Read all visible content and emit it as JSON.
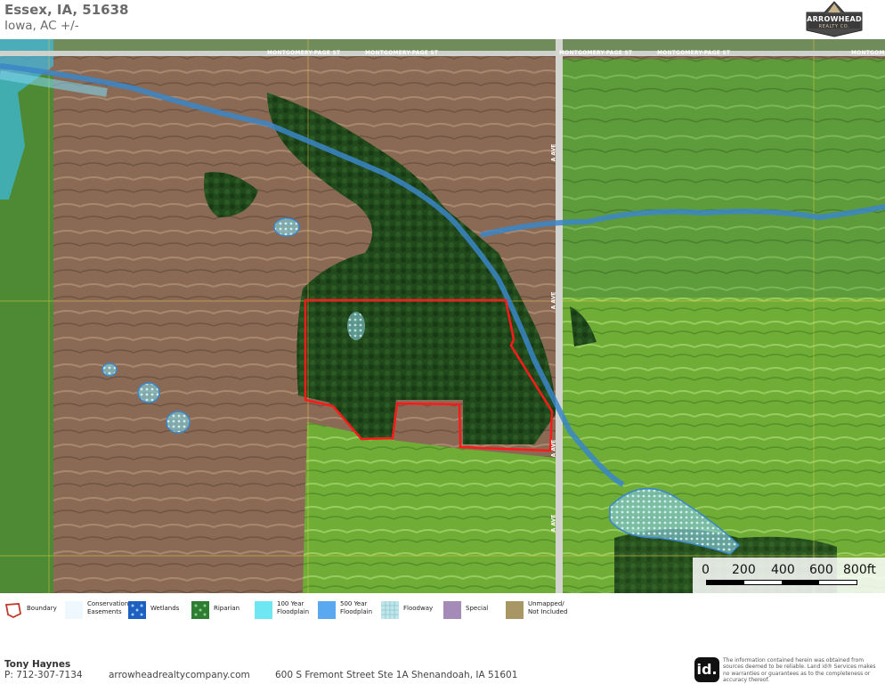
{
  "header": {
    "title": "Essex, IA, 51638",
    "subtitle": "Iowa,  AC +/-",
    "logo_text": "ARROWHEAD",
    "logo_sub": "REALTY CO."
  },
  "map": {
    "road_labels": [
      "MONTGOMERY-PAGE ST",
      "MONTGOMERY-PAGE ST",
      "MONTGOMERY-PAGE ST",
      "MONTGOMERY-PAGE ST",
      "MONTGOM"
    ],
    "avenue_labels": [
      "A AVE",
      "A AVE",
      "A AVE",
      "A AVE"
    ],
    "colors": {
      "boundary": "#ff1a1a",
      "stream": "#3a86c8",
      "floodway": "#9fd3dc",
      "field_brown": "#8a6a55",
      "field_green": "#5f9a3c",
      "forest": "#1f4a1c"
    }
  },
  "scalebar": {
    "labels": [
      "0",
      "200",
      "400",
      "600",
      "800ft"
    ]
  },
  "legend": {
    "items": [
      {
        "label": "Boundary",
        "icon": "boundary-icon",
        "color": "#c0392b"
      },
      {
        "label": "Conservation\nEasements",
        "icon": "conservation-icon",
        "color": "#f0f8ff"
      },
      {
        "label": "Wetlands",
        "icon": "wetlands-icon",
        "color": "#1e5fbf"
      },
      {
        "label": "Riparian",
        "icon": "riparian-icon",
        "color": "#2e7d32"
      },
      {
        "label": "100 Year\nFloodplain",
        "icon": "floodplain-100-icon",
        "color": "#6fe7f2"
      },
      {
        "label": "500 Year\nFloodplain",
        "icon": "floodplain-500-icon",
        "color": "#5aa8f0"
      },
      {
        "label": "Floodway",
        "icon": "floodway-icon",
        "color": "#bfe6ea"
      },
      {
        "label": "Special",
        "icon": "special-icon",
        "color": "#a58bb8"
      },
      {
        "label": "Unmapped/\nNot Included",
        "icon": "unmapped-icon",
        "color": "#a89664"
      }
    ]
  },
  "footer": {
    "agent_name": "Tony Haynes",
    "agent_phone": "P: 712-307-7134",
    "website": "arrowheadrealtycompany.com",
    "address": "600 S Fremont Street Ste 1A Shenandoah, IA 51601",
    "id_logo": "id.",
    "disclaimer": "The information contained herein was obtained from sources deemed to be reliable. Land id® Services makes no warranties or guarantees as to the completeness or accuracy thereof."
  }
}
